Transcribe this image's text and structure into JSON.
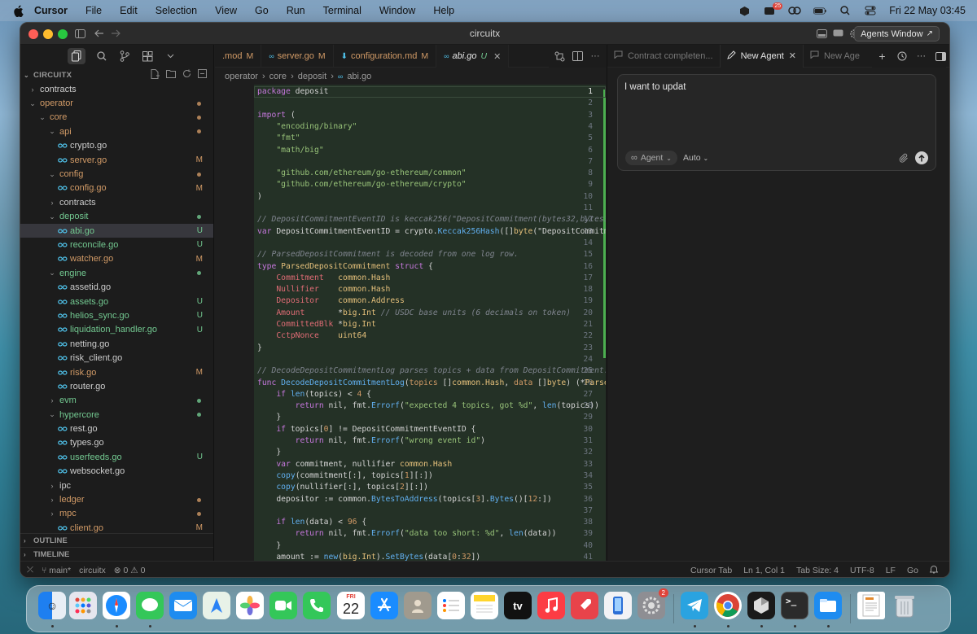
{
  "menubar": {
    "app": "Cursor",
    "items": [
      "File",
      "Edit",
      "Selection",
      "View",
      "Go",
      "Run",
      "Terminal",
      "Window",
      "Help"
    ],
    "datetime": "Fri 22 May  03:45",
    "notif_badge": "25"
  },
  "window": {
    "title": "circuitx",
    "agents_window": "Agents Window"
  },
  "sidebar": {
    "root": "CIRCUITX",
    "outline": "OUTLINE",
    "timeline": "TIMELINE",
    "rows": [
      {
        "label": "contracts",
        "depth": 0,
        "type": "folder",
        "open": false
      },
      {
        "label": "operator",
        "depth": 0,
        "type": "folder",
        "open": true,
        "dot": "#d19a66",
        "color": "#d19a66"
      },
      {
        "label": "core",
        "depth": 1,
        "type": "folder",
        "open": true,
        "dot": "#d19a66",
        "color": "#d19a66"
      },
      {
        "label": "api",
        "depth": 2,
        "type": "folder",
        "open": true,
        "dot": "#d19a66",
        "color": "#d19a66"
      },
      {
        "label": "crypto.go",
        "depth": 3,
        "type": "file"
      },
      {
        "label": "server.go",
        "depth": 3,
        "type": "file",
        "status": "M",
        "color": "#d19a66"
      },
      {
        "label": "config",
        "depth": 2,
        "type": "folder",
        "open": true,
        "dot": "#d19a66",
        "color": "#d19a66"
      },
      {
        "label": "config.go",
        "depth": 3,
        "type": "file",
        "status": "M",
        "color": "#d19a66"
      },
      {
        "label": "contracts",
        "depth": 2,
        "type": "folder",
        "open": false
      },
      {
        "label": "deposit",
        "depth": 2,
        "type": "folder",
        "open": true,
        "dot": "#73c991",
        "color": "#73c991"
      },
      {
        "label": "abi.go",
        "depth": 3,
        "type": "file",
        "status": "U",
        "color": "#73c991",
        "selected": true
      },
      {
        "label": "reconcile.go",
        "depth": 3,
        "type": "file",
        "status": "U",
        "color": "#73c991"
      },
      {
        "label": "watcher.go",
        "depth": 3,
        "type": "file",
        "status": "M",
        "color": "#d19a66"
      },
      {
        "label": "engine",
        "depth": 2,
        "type": "folder",
        "open": true,
        "dot": "#73c991",
        "color": "#73c991"
      },
      {
        "label": "assetid.go",
        "depth": 3,
        "type": "file"
      },
      {
        "label": "assets.go",
        "depth": 3,
        "type": "file",
        "status": "U",
        "color": "#73c991"
      },
      {
        "label": "helios_sync.go",
        "depth": 3,
        "type": "file",
        "status": "U",
        "color": "#73c991"
      },
      {
        "label": "liquidation_handler.go",
        "depth": 3,
        "type": "file",
        "status": "U",
        "color": "#73c991"
      },
      {
        "label": "netting.go",
        "depth": 3,
        "type": "file"
      },
      {
        "label": "risk_client.go",
        "depth": 3,
        "type": "file"
      },
      {
        "label": "risk.go",
        "depth": 3,
        "type": "file",
        "status": "M",
        "color": "#d19a66"
      },
      {
        "label": "router.go",
        "depth": 3,
        "type": "file"
      },
      {
        "label": "evm",
        "depth": 2,
        "type": "folder",
        "open": false,
        "dot": "#73c991",
        "color": "#73c991"
      },
      {
        "label": "hypercore",
        "depth": 2,
        "type": "folder",
        "open": true,
        "dot": "#73c991",
        "color": "#73c991"
      },
      {
        "label": "rest.go",
        "depth": 3,
        "type": "file"
      },
      {
        "label": "types.go",
        "depth": 3,
        "type": "file"
      },
      {
        "label": "userfeeds.go",
        "depth": 3,
        "type": "file",
        "status": "U",
        "color": "#73c991"
      },
      {
        "label": "websocket.go",
        "depth": 3,
        "type": "file"
      },
      {
        "label": "ipc",
        "depth": 2,
        "type": "folder",
        "open": false
      },
      {
        "label": "ledger",
        "depth": 2,
        "type": "folder",
        "open": false,
        "dot": "#d19a66",
        "color": "#d19a66"
      },
      {
        "label": "mpc",
        "depth": 2,
        "type": "folder",
        "open": false,
        "dot": "#d19a66",
        "color": "#d19a66"
      },
      {
        "label": "client.go",
        "depth": 3,
        "type": "file",
        "status": "M",
        "color": "#d19a66"
      }
    ]
  },
  "editor": {
    "tabs": [
      {
        "label": ".mod",
        "status": "M",
        "icon": "none",
        "active": false
      },
      {
        "label": "server.go",
        "status": "M",
        "icon": "go-icon",
        "active": false
      },
      {
        "label": "configuration.md",
        "status": "M",
        "icon": "md-icon",
        "active": false
      },
      {
        "label": "abi.go",
        "status": "U",
        "icon": "go-icon",
        "active": true
      }
    ],
    "breadcrumb": [
      "operator",
      "core",
      "deposit",
      "abi.go"
    ],
    "lines": [
      [
        [
          "k",
          "package "
        ],
        [
          "p",
          "deposit"
        ]
      ],
      [],
      [
        [
          "k",
          "import "
        ],
        [
          "p",
          "("
        ]
      ],
      [
        [
          "p",
          "    "
        ],
        [
          "s",
          "\"encoding/binary\""
        ]
      ],
      [
        [
          "p",
          "    "
        ],
        [
          "s",
          "\"fmt\""
        ]
      ],
      [
        [
          "p",
          "    "
        ],
        [
          "s",
          "\"math/big\""
        ]
      ],
      [],
      [
        [
          "p",
          "    "
        ],
        [
          "s",
          "\"github.com/ethereum/go-ethereum/common\""
        ]
      ],
      [
        [
          "p",
          "    "
        ],
        [
          "s",
          "\"github.com/ethereum/go-ethereum/crypto\""
        ]
      ],
      [
        [
          "p",
          ")"
        ]
      ],
      [],
      [
        [
          "c",
          "// DepositCommitmentEventID is keccak256(\"DepositCommitment(bytes32,bytes32,ad"
        ]
      ],
      [
        [
          "k",
          "var "
        ],
        [
          "p",
          "DepositCommitmentEventID = crypto."
        ],
        [
          "f",
          "Keccak256Hash"
        ],
        [
          "p",
          "([]"
        ],
        [
          "t",
          "byte"
        ],
        [
          "p",
          "(\"DepositCommitmen"
        ]
      ],
      [],
      [
        [
          "c",
          "// ParsedDepositCommitment is decoded from one log row."
        ]
      ],
      [
        [
          "k",
          "type "
        ],
        [
          "t",
          "ParsedDepositCommitment "
        ],
        [
          "k",
          "struct "
        ],
        [
          "p",
          "{"
        ]
      ],
      [
        [
          "p",
          "    "
        ],
        [
          "fd",
          "Commitment   "
        ],
        [
          "t",
          "common.Hash"
        ]
      ],
      [
        [
          "p",
          "    "
        ],
        [
          "fd",
          "Nullifier    "
        ],
        [
          "t",
          "common.Hash"
        ]
      ],
      [
        [
          "p",
          "    "
        ],
        [
          "fd",
          "Depositor    "
        ],
        [
          "t",
          "common.Address"
        ]
      ],
      [
        [
          "p",
          "    "
        ],
        [
          "fd",
          "Amount       "
        ],
        [
          "p",
          "*"
        ],
        [
          "t",
          "big.Int "
        ],
        [
          "c",
          "// USDC base units (6 decimals on token)"
        ]
      ],
      [
        [
          "p",
          "    "
        ],
        [
          "fd",
          "CommittedBlk "
        ],
        [
          "p",
          "*"
        ],
        [
          "t",
          "big.Int"
        ]
      ],
      [
        [
          "p",
          "    "
        ],
        [
          "fd",
          "CctpNonce    "
        ],
        [
          "t",
          "uint64"
        ]
      ],
      [
        [
          "p",
          "}"
        ]
      ],
      [],
      [
        [
          "c",
          "// DecodeDepositCommitmentLog parses topics + data from DepositCommitment."
        ]
      ],
      [
        [
          "k",
          "func "
        ],
        [
          "f",
          "DecodeDepositCommitmentLog"
        ],
        [
          "p",
          "("
        ],
        [
          "n",
          "topics "
        ],
        [
          "p",
          "[]"
        ],
        [
          "t",
          "common.Hash"
        ],
        [
          "p",
          ", "
        ],
        [
          "n",
          "data "
        ],
        [
          "p",
          "[]"
        ],
        [
          "t",
          "byte"
        ],
        [
          "p",
          ") (*"
        ],
        [
          "t",
          "Parsed"
        ]
      ],
      [
        [
          "p",
          "    "
        ],
        [
          "k",
          "if "
        ],
        [
          "f",
          "len"
        ],
        [
          "p",
          "(topics) < "
        ],
        [
          "n",
          "4"
        ],
        [
          "p",
          " {"
        ]
      ],
      [
        [
          "p",
          "        "
        ],
        [
          "k",
          "return "
        ],
        [
          "p",
          "nil, fmt."
        ],
        [
          "f",
          "Errorf"
        ],
        [
          "p",
          "("
        ],
        [
          "s",
          "\"expected 4 topics, got %d\""
        ],
        [
          "p",
          ", "
        ],
        [
          "f",
          "len"
        ],
        [
          "p",
          "(topics))"
        ]
      ],
      [
        [
          "p",
          "    }"
        ]
      ],
      [
        [
          "p",
          "    "
        ],
        [
          "k",
          "if "
        ],
        [
          "p",
          "topics["
        ],
        [
          "n",
          "0"
        ],
        [
          "p",
          "] != DepositCommitmentEventID {"
        ]
      ],
      [
        [
          "p",
          "        "
        ],
        [
          "k",
          "return "
        ],
        [
          "p",
          "nil, fmt."
        ],
        [
          "f",
          "Errorf"
        ],
        [
          "p",
          "("
        ],
        [
          "s",
          "\"wrong event id\""
        ],
        [
          "p",
          ")"
        ]
      ],
      [
        [
          "p",
          "    }"
        ]
      ],
      [
        [
          "p",
          "    "
        ],
        [
          "k",
          "var "
        ],
        [
          "p",
          "commitment, nullifier "
        ],
        [
          "t",
          "common.Hash"
        ]
      ],
      [
        [
          "p",
          "    "
        ],
        [
          "f",
          "copy"
        ],
        [
          "p",
          "(commitment[:], topics["
        ],
        [
          "n",
          "1"
        ],
        [
          "p",
          "][:])"
        ]
      ],
      [
        [
          "p",
          "    "
        ],
        [
          "f",
          "copy"
        ],
        [
          "p",
          "(nullifier[:], topics["
        ],
        [
          "n",
          "2"
        ],
        [
          "p",
          "][:])"
        ]
      ],
      [
        [
          "p",
          "    depositor := common."
        ],
        [
          "f",
          "BytesToAddress"
        ],
        [
          "p",
          "(topics["
        ],
        [
          "n",
          "3"
        ],
        [
          "p",
          "]."
        ],
        [
          "f",
          "Bytes"
        ],
        [
          "p",
          "()["
        ],
        [
          "n",
          "12"
        ],
        [
          "p",
          ":])"
        ]
      ],
      [],
      [
        [
          "p",
          "    "
        ],
        [
          "k",
          "if "
        ],
        [
          "f",
          "len"
        ],
        [
          "p",
          "(data) < "
        ],
        [
          "n",
          "96"
        ],
        [
          "p",
          " {"
        ]
      ],
      [
        [
          "p",
          "        "
        ],
        [
          "k",
          "return "
        ],
        [
          "p",
          "nil, fmt."
        ],
        [
          "f",
          "Errorf"
        ],
        [
          "p",
          "("
        ],
        [
          "s",
          "\"data too short: %d\""
        ],
        [
          "p",
          ", "
        ],
        [
          "f",
          "len"
        ],
        [
          "p",
          "(data))"
        ]
      ],
      [
        [
          "p",
          "    }"
        ]
      ],
      [
        [
          "p",
          "    amount := "
        ],
        [
          "f",
          "new"
        ],
        [
          "p",
          "("
        ],
        [
          "t",
          "big.Int"
        ],
        [
          "p",
          ")."
        ],
        [
          "f",
          "SetBytes"
        ],
        [
          "p",
          "(data["
        ],
        [
          "n",
          "0"
        ],
        [
          "p",
          ":"
        ],
        [
          "n",
          "32"
        ],
        [
          "p",
          "])"
        ]
      ]
    ]
  },
  "agent": {
    "tabs": [
      "Contract completen...",
      "New Agent",
      "New Age"
    ],
    "input_text": "I want to updat",
    "mode": "Agent",
    "model": "Auto"
  },
  "statusbar": {
    "branch": "main*",
    "project": "circuitx",
    "problems": "0",
    "warnings": "0",
    "items": [
      "Cursor Tab",
      "Ln 1, Col 1",
      "Tab Size: 4",
      "UTF-8",
      "LF",
      "Go"
    ]
  },
  "dock": {
    "calendar_month": "FRI",
    "calendar_day": "22",
    "settings_badge": "2",
    "tv_label": "tv"
  }
}
